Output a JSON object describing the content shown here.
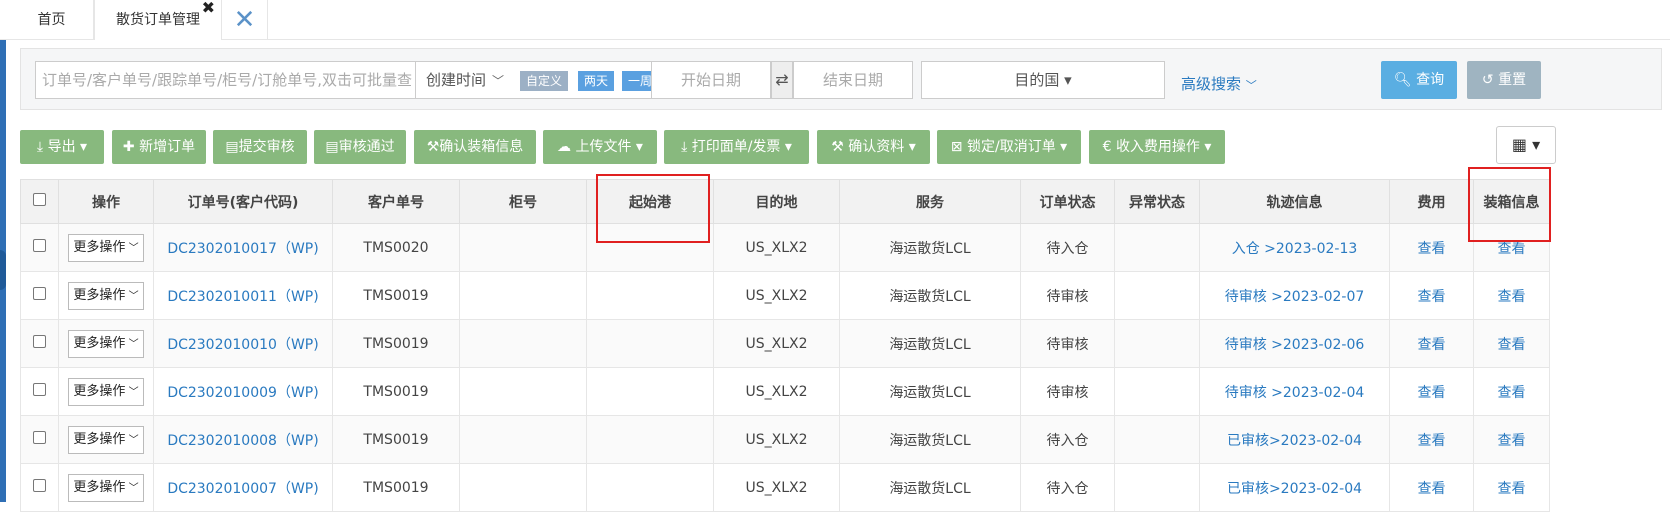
{
  "tabs": {
    "home": "首页",
    "active": "散货订单管理",
    "close_glyph": "✖"
  },
  "search": {
    "keyword_placeholder": "订单号/客户单号/跟踪单号/柜号/订舱单号,双击可批量查",
    "time_field": "创建时间",
    "pill_custom": "自定义",
    "pill_two_days": "两天",
    "pill_week": "一周",
    "start_date": "开始日期",
    "end_date": "结束日期",
    "destination": "目的国",
    "advanced": "高级搜索",
    "query": "查询",
    "reset": "重置"
  },
  "toolbar": [
    {
      "label": "导出"
    },
    {
      "label": "新增订单"
    },
    {
      "label": "提交审核"
    },
    {
      "label": "审核通过"
    },
    {
      "label": "确认装箱信息"
    },
    {
      "label": "上传文件"
    },
    {
      "label": "打印面单/发票"
    },
    {
      "label": "确认资料"
    },
    {
      "label": "锁定/取消订单"
    },
    {
      "label": "收入费用操作"
    }
  ],
  "table": {
    "headers": [
      "操作",
      "订单号(客户代码)",
      "客户单号",
      "柜号",
      "起始港",
      "目的地",
      "服务",
      "订单状态",
      "异常状态",
      "轨迹信息",
      "费用",
      "装箱信息"
    ],
    "more_label": "更多操作",
    "view_label": "查看",
    "rows": [
      {
        "order": "DC2302010017（WP)",
        "cust": "TMS0020",
        "box": "",
        "port": "",
        "dest": "US_XLX2",
        "service": "海运散货LCL",
        "status": "待入仓",
        "abn": "",
        "track": "入仓 >2023-02-13"
      },
      {
        "order": "DC2302010011（WP)",
        "cust": "TMS0019",
        "box": "",
        "port": "",
        "dest": "US_XLX2",
        "service": "海运散货LCL",
        "status": "待审核",
        "abn": "",
        "track": "待审核 >2023-02-07"
      },
      {
        "order": "DC2302010010（WP)",
        "cust": "TMS0019",
        "box": "",
        "port": "",
        "dest": "US_XLX2",
        "service": "海运散货LCL",
        "status": "待审核",
        "abn": "",
        "track": "待审核 >2023-02-06"
      },
      {
        "order": "DC2302010009（WP)",
        "cust": "TMS0019",
        "box": "",
        "port": "",
        "dest": "US_XLX2",
        "service": "海运散货LCL",
        "status": "待审核",
        "abn": "",
        "track": "待审核 >2023-02-04"
      },
      {
        "order": "DC2302010008（WP)",
        "cust": "TMS0019",
        "box": "",
        "port": "",
        "dest": "US_XLX2",
        "service": "海运散货LCL",
        "status": "待入仓",
        "abn": "",
        "track": "已审核>2023-02-04"
      },
      {
        "order": "DC2302010007（WP)",
        "cust": "TMS0019",
        "box": "",
        "port": "",
        "dest": "US_XLX2",
        "service": "海运散货LCL",
        "status": "待入仓",
        "abn": "",
        "track": "已审核>2023-02-04"
      }
    ]
  }
}
